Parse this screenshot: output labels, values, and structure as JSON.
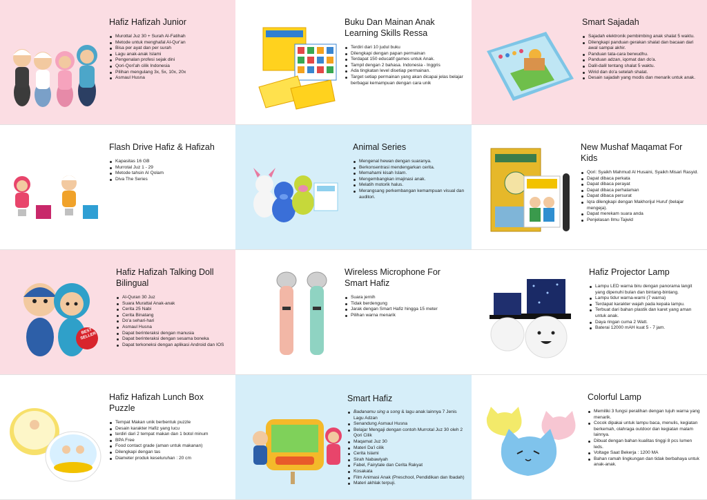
{
  "products": [
    {
      "title": "Hafiz Hafizah Junior",
      "features": [
        "Murottal Juz 30 + Surah Al-Fatihah",
        "Metode untuk menghafal Al-Qur'an",
        "Bisa per ayat dan per surah",
        "Lagu anak-anak Islami",
        "Pengenalan profesi sejak dini",
        "Qori-Qori'ah cilik Indonesia",
        "Pilihan mengulang 3x, 5x, 10x, 20x",
        "Asmaul Husna"
      ]
    },
    {
      "title": "Buku Dan Mainan Anak Learning Skills Ressa",
      "features": [
        "Terdiri dari 10 judul buku",
        "Dilengkapi dengan papan permainan",
        "Terdapat 150 educatif games untuk Anak.",
        "Tampil dengan 2 bahasa. Indonesia - Inggris",
        "Ada tingkatan level disetiap permainan.",
        "Target setiap permainan yang akan dicapai jelas belajar berbagai kemampuan dengan cara unik"
      ]
    },
    {
      "title": "Smart Sajadah",
      "features": [
        "Sajadah elektronik pembimbing anak shalat 5 waktu.",
        "Dilengkapi panduan gerakan shalat dan bacaan dari awal sampai akhir.",
        "Panduan tata-cara berwudhu.",
        "Panduan adzan, iqomat dan do'a.",
        "Dalil-dalil tentang shalat 5 waktu.",
        "Wirid dan do'a setelah shalat.",
        "Desain sajadah yang modis dan menarik untuk anak."
      ]
    },
    {
      "title": "Flash Drive Hafiz & Hafizah",
      "features": [
        "Kapasitas 16 GB",
        "Murrotal Juz 1 - 29",
        "Metode tahsin Al Qolam",
        "Diva The Series"
      ]
    },
    {
      "title": "Animal Series",
      "features": [
        "Mengenal hewan dengan suaranya.",
        "Berkonsentrasi mendengarkan cerita.",
        "Memahami kisah Islam.",
        "Mengembangkan imajinasi anak.",
        "Melatih motorik halus.",
        "Merangsang perkembangan kemampuan visual dan auditori."
      ]
    },
    {
      "title": "New Mushaf Maqamat For Kids",
      "features": [
        "Qori: Syaikh Mahmud Al Husaini, Syaikh Misari Rasyid.",
        "Dapat dibaca perkata",
        "Dapat dibaca perayat",
        "Dapat dibaca perhalaman",
        "Dapat dibaca persurat",
        "Iqra dilengkapi dengan Makhorijul Huruf (belajar mengeja).",
        "Dapat merekam suara anda",
        "Penjelasan Ilmu Tajwid"
      ]
    },
    {
      "title": "Hafiz Hafizah Talking Doll Bilingual",
      "badge": "BEST SELLER",
      "features": [
        "Al-Quran 30 Juz",
        "Suara Murattal Anak-anak",
        "Cerita 25 Nabi",
        "Cerita Binatang",
        "Do'a sehari-hari",
        "Asmaul Husna",
        "Dapat berinteraksi dengan manusia",
        "Dapat berinteraksi dengan sesama boneka",
        "Dapat terkoneksi dengan aplikasi Android dan IOS"
      ]
    },
    {
      "title": "Wireless Microphone For Smart Hafiz",
      "features": [
        "Suara jernih",
        "Tidak berdengung",
        "Jarak dengan Smart Hafiz hingga 15 meter",
        "Pilihan warna menarik"
      ]
    },
    {
      "title": "Hafiz Projector Lamp",
      "features": [
        "Lampu LED warna biru dengan panorama langit yang dipenuhi bulan dan bintang-bintang.",
        "Lampu tidur warna-warni (7 warna)",
        "Terdapat karakter wajah pada kepala lampu.",
        "Terbuat dari bahan plastik dan karet yang aman untuk anak.",
        "Daya ringan cuma 2 Watt.",
        "Baterai 12000 mAH kuat 5 - 7 jam."
      ]
    },
    {
      "title": "Hafiz Hafizah Lunch Box Puzzle",
      "features": [
        "Tempat Makan unik berbentuk puzzle",
        "Desain karakter Hafiz yang lucu",
        "terdiri dari 2 tempat makan dan 1 botol minum",
        "BPA Free",
        "Food contact grade (aman untuk makanan)",
        "Dilengkapi dengan tas",
        "Diameter produk keseluruhan : 20 cm"
      ]
    },
    {
      "title": "Smart Hafiz",
      "features_first_italic": "Badanamu sing a song",
      "features_first_rest": " & lagu anak lainnya 7 Jenis Lagu Adzan",
      "features": [
        "Senandung Asmaul Husna",
        "Belajar Mengaji dengan contoh Murrotal Juz 30 oleh 2 Qori Cilik",
        "Maqamat Juz 30",
        "Materi Da'i cilik",
        "Cerita Islami",
        "Sirah Nabawiyah",
        "Fabel, Fairytale dan Cerita Rakyat",
        "Kosakata",
        "Film Animasi Anak (Preschool, Pendidikan dan Ibadah)",
        "Materi akhlak terpuji."
      ]
    },
    {
      "title": "Colorful Lamp",
      "features": [
        "Memiliki 3 fungsi peralihan dengan tujuh warna yang menarik.",
        "Cocok dipakai untuk lampu baca, menulis, kegiatan berkemah, olahraga outdoor dan kegiatan malam lainnya.",
        "Dibuat dengan bahan kualitas tinggi 8 pcs lumen leds.",
        "Voltage Saat Bekerja : 1200 MA",
        "Bahan ramah lingkungan dan tidak berbahaya untuk anak-anak."
      ]
    }
  ],
  "colors": {
    "pink": "#fbdde3",
    "blue": "#d6eef9",
    "white": "#ffffff"
  }
}
